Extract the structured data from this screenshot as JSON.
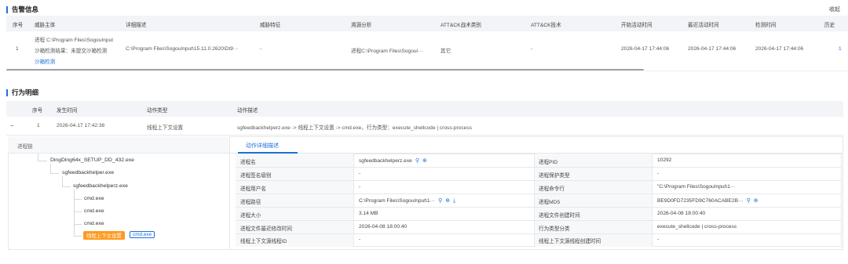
{
  "alert_section": {
    "title": "告警信息",
    "collapse_label": "收起",
    "columns": [
      "序号",
      "威胁主体",
      "详细描述",
      "威胁特征",
      "溯源分析",
      "ATT&CK战术类别",
      "ATT&CK技术",
      "开始活动时间",
      "最近活动时间",
      "检测时间",
      "历史"
    ],
    "row": {
      "index": "1",
      "subject_process": "进程 C:\\Program Files\\SogouInput",
      "subject_sandbox": "沙箱检测结果：未提交沙箱检测",
      "subject_link": "沙箱检测",
      "description": "C:\\Program Files\\SogouInput\\15.11.0.2620\\Dt9···",
      "feature": "-",
      "trace": "进程C:\\Program Files\\Sogoul···",
      "tactic": "其它",
      "technique": "-",
      "start_time": "2026-04-17 17:44:06",
      "last_time": "2026-04-17 17:44:06",
      "detect_time": "2026-04-17 17:44:06",
      "history": "1"
    }
  },
  "behavior_section": {
    "title": "行为明细",
    "columns": [
      "序号",
      "发生时间",
      "动作类型",
      "动作描述"
    ],
    "row": {
      "toggle": "−",
      "index": "1",
      "time": "2026-04-17 17:42:38",
      "action_type": "线程上下文设置",
      "action_desc": "sgfeedbackhelperz.exe -> 线程上下文设置 -> cmd.exe，行为类型：execute_shellcode | cross-process"
    }
  },
  "process_chain": {
    "title": "进程链",
    "nodes": [
      "DingDing64x_SETUP_DD_432.exe",
      "sgfeedbackhelper.exe",
      "sgfeedbackhelperz.exe",
      "cmd.exe",
      "cmd.exe",
      "cmd.exe"
    ],
    "tag_action": "线程上下文设置",
    "tag_target": "cmd.exe"
  },
  "detail_tab": {
    "title": "动作详细描述",
    "rows": [
      {
        "l1": "进程名",
        "v1": "sgfeedbackhelperz.exe",
        "l2": "进程PID",
        "v2": "10292"
      },
      {
        "l1": "进程签名级别",
        "v1": "-",
        "l2": "进程保护类型",
        "v2": "-"
      },
      {
        "l1": "进程用户名",
        "v1": "-",
        "l2": "进程命令行",
        "v2": "\"C:\\Program Files\\SogouInput\\1···"
      },
      {
        "l1": "进程路径",
        "v1": "C:\\Program Files\\SogouInput\\1···",
        "l2": "进程MD5",
        "v2": "BE9D0FD7235FD9C760ACABE2B···"
      },
      {
        "l1": "进程大小",
        "v1": "3.14 MB",
        "l2": "进程文件创建时间",
        "v2": "2026-04-08 18:00:40"
      },
      {
        "l1": "进程文件最近修改时间",
        "v1": "2026-04-08 18:00:40",
        "l2": "行为类型分类",
        "v2": "execute_shellcode | cross-process"
      },
      {
        "l1": "线程上下文源线程ID",
        "v1": "-",
        "l2": "线程上下文源线程创建时间",
        "v2": "-"
      }
    ]
  },
  "colors": {
    "accent": "#1e6fd9",
    "orange": "#ff9a1f",
    "header_bg": "#f2f4f7"
  }
}
